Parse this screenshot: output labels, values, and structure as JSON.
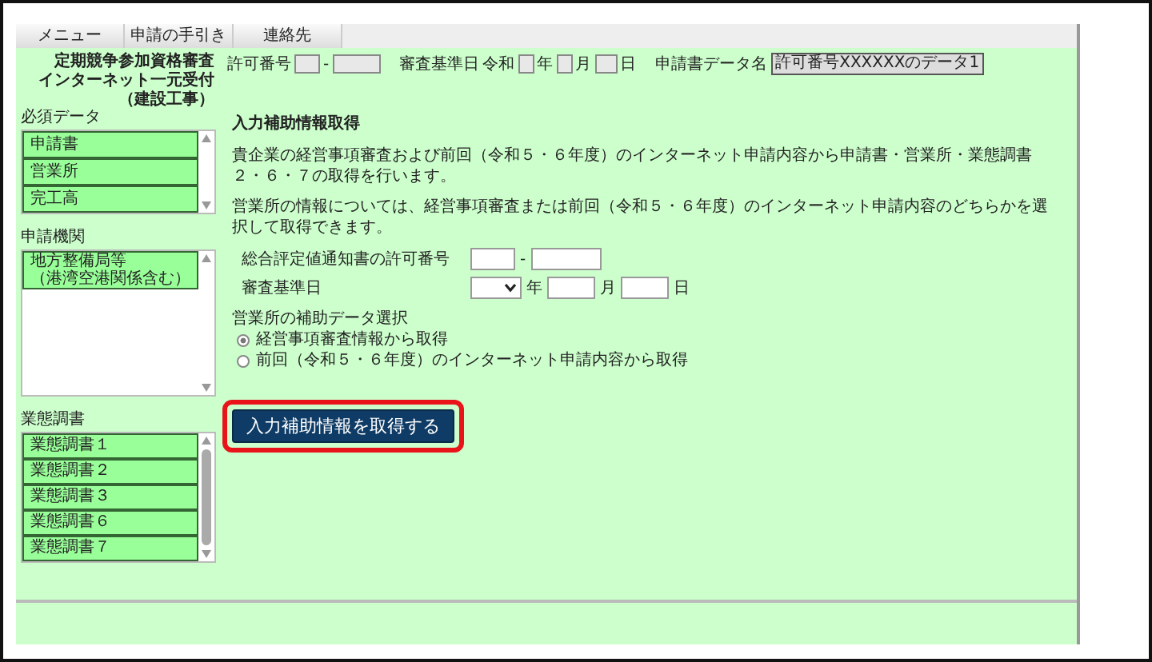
{
  "tabs": [
    {
      "label": "メニュー"
    },
    {
      "label": "申請の手引き"
    },
    {
      "label": "連絡先"
    }
  ],
  "system_title": [
    "定期競争参加資格審査",
    "インターネット一元受付",
    "（建設工事）"
  ],
  "header": {
    "permit_label": "許可番号",
    "permit_separator": "-",
    "review_label": "審査基準日",
    "era": "令和",
    "year_unit": "年",
    "month_unit": "月",
    "day_unit": "日",
    "data_name_label": "申請書データ名",
    "data_name_value": "許可番号XXXXXXのデータ1"
  },
  "sidebar": [
    {
      "title": "必須データ",
      "items": [
        "申請書",
        "営業所",
        "完工高"
      ],
      "scroll_thumb": false
    },
    {
      "title": "申請機関",
      "items": [
        "地方整備局等",
        "（港湾空港関係含む）"
      ],
      "multiline": true,
      "scroll_thumb": false
    },
    {
      "title": "業態調書",
      "items": [
        "業態調書１",
        "業態調書２",
        "業態調書３",
        "業態調書６",
        "業態調書７"
      ],
      "scroll_thumb": true
    }
  ],
  "main": {
    "heading": "入力補助情報取得",
    "paragraphs": [
      "貴企業の経営事項審査および前回（令和５・６年度）のインターネット申請内容から申請書・営業所・業態調書２・６・７の取得を行います。",
      "営業所の情報については、経営事項審査または前回（令和５・６年度）のインターネット申請内容のどちらかを選択して取得できます。"
    ],
    "permit_row": {
      "label": "総合評定値通知書の許可番号",
      "separator": "-"
    },
    "date_row": {
      "label": "審査基準日",
      "year_unit": "年",
      "month_unit": "月",
      "day_unit": "日"
    },
    "source_select": {
      "label": "営業所の補助データ選択",
      "options": [
        {
          "label": "経営事項審査情報から取得",
          "selected": true
        },
        {
          "label": "前回（令和５・６年度）のインターネット申請内容から取得",
          "selected": false
        }
      ]
    },
    "fetch_button": {
      "label": "入力補助情報を取得する",
      "highlighted": true
    }
  }
}
